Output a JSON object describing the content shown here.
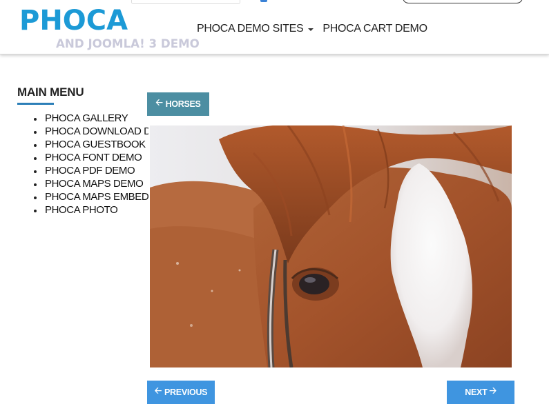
{
  "header": {
    "logo_text": "PHOCA",
    "logo_subtitle": "AND JOOMLA! 3 DEMO",
    "nav": [
      {
        "label": "PHOCA DEMO SITES",
        "has_dropdown": true
      },
      {
        "label": "PHOCA CART DEMO",
        "has_dropdown": false
      }
    ]
  },
  "sidebar": {
    "title": "MAIN MENU",
    "items": [
      {
        "label": "PHOCA GALLERY"
      },
      {
        "label": "PHOCA DOWNLOAD DEMO"
      },
      {
        "label": "PHOCA GUESTBOOK"
      },
      {
        "label": "PHOCA FONT DEMO"
      },
      {
        "label": "PHOCA PDF DEMO"
      },
      {
        "label": "PHOCA MAPS DEMO"
      },
      {
        "label": "PHOCA MAPS EMBED"
      },
      {
        "label": "PHOCA PHOTO"
      }
    ]
  },
  "main": {
    "back_button": {
      "label": "HORSES",
      "icon": "arrow-left-icon"
    },
    "photo": {
      "subject": "horse-head-photo"
    },
    "prev_button": {
      "label": "PREVIOUS",
      "icon": "arrow-left-icon"
    },
    "next_button": {
      "label": "NEXT",
      "icon": "arrow-right-icon"
    }
  },
  "colors": {
    "logo": "#1c9ad6",
    "logo_subtitle": "#c9c9da",
    "back_button": "#4c8ea2",
    "nav_buttons": "#3f95e0",
    "menu_underline": "#2c7fb8"
  }
}
